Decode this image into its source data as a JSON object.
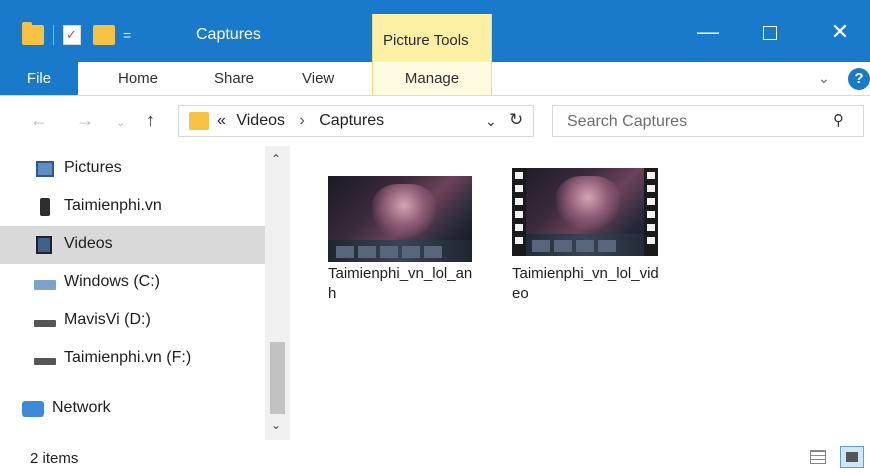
{
  "window": {
    "title": "Captures",
    "contextual_group": "Picture Tools",
    "quick_access_dropdown": "=",
    "controls": {
      "minimize": "—",
      "close": "✕"
    }
  },
  "ribbon": {
    "tabs": [
      {
        "label": "File"
      },
      {
        "label": "Home"
      },
      {
        "label": "Share"
      },
      {
        "label": "View"
      },
      {
        "label": "Manage"
      }
    ],
    "collapse_chevron": "⌄",
    "help": "?"
  },
  "navigation": {
    "back": "←",
    "forward": "→",
    "recent": "⌄",
    "up": "↑",
    "address": {
      "overflow": "«",
      "segments": [
        "Videos",
        "Captures"
      ],
      "separator": "›",
      "dropdown": "⌄",
      "refresh": "↻"
    },
    "search": {
      "placeholder": "Search Captures",
      "icon": "⚲"
    }
  },
  "sidebar": {
    "items": [
      {
        "label": "Pictures",
        "icon": "pictures-icon",
        "selected": false
      },
      {
        "label": "Taimienphi.vn",
        "icon": "phone-icon",
        "selected": false
      },
      {
        "label": "Videos",
        "icon": "videos-icon",
        "selected": true
      },
      {
        "label": "Windows (C:)",
        "icon": "windows-drive-icon",
        "selected": false
      },
      {
        "label": "MavisVi (D:)",
        "icon": "drive-icon",
        "selected": false
      },
      {
        "label": "Taimienphi.vn (F:)",
        "icon": "drive-icon",
        "selected": false
      },
      {
        "label": "Network",
        "icon": "network-icon",
        "selected": false
      }
    ],
    "scroll_up": "⌃",
    "scroll_down": "⌄"
  },
  "files": [
    {
      "name": "Taimienphi_vn_lol_anh",
      "type": "image"
    },
    {
      "name": "Taimienphi_vn_lol_video",
      "type": "video"
    }
  ],
  "status": {
    "item_count": "2 items"
  },
  "colors": {
    "titlebar": "#1979ca",
    "contextual_tab": "#fbf0a4",
    "selection": "#d9d9d9",
    "folder": "#f5c243"
  }
}
